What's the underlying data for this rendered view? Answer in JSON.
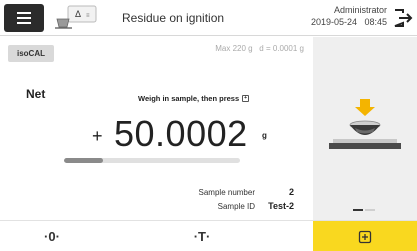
{
  "header": {
    "title": "Residue on ignition",
    "method_icon": "crucible-delta-icon",
    "user": "Administrator",
    "datetime": "2019-05-24   08:45"
  },
  "main": {
    "isocal_label": "isoCAL",
    "max_info": "Max 220 g   d = 0.0001 g",
    "net_label": "Net",
    "instruction": "Weigh in sample, then press",
    "sign": "+",
    "weight_value": "50.0002",
    "unit": "g",
    "progress_fraction": 0.22,
    "sample_number_label": "Sample number",
    "sample_number_value": "2",
    "sample_id_label": "Sample ID",
    "sample_id_value": "Test-2"
  },
  "side_panel": {
    "illustration": "balance-with-crucible-arrow-down",
    "page_count": 2,
    "active_page": 1
  },
  "bottom_bar": {
    "zero_label": "·0·",
    "tare_label": "·T·",
    "add_icon": "add-sample-icon"
  },
  "colors": {
    "accent_yellow": "#f9d81f",
    "menu_dark": "#2b2b2b",
    "panel_gray": "#efefef"
  }
}
